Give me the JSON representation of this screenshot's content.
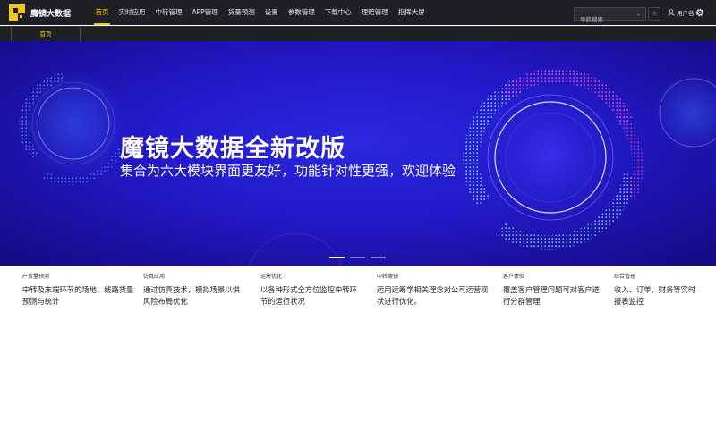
{
  "header": {
    "logo_text": "魔镜大数据",
    "nav": [
      "首页",
      "实时应用",
      "中转管理",
      "APP管理",
      "货量预测",
      "设置",
      "参数管理",
      "下载中心",
      "理赔管理",
      "指挥大屏"
    ],
    "active_nav": 0,
    "search_placeholder": "导航搜索",
    "user_label": "用户名"
  },
  "tabs": [
    "首页"
  ],
  "banner": {
    "title": "魔镜大数据全新改版",
    "subtitle": "集合为六大模块界面更友好，功能针对性更强，欢迎体验",
    "slide_count": 3,
    "active_slide": 0
  },
  "modules": [
    {
      "category": "产货量预测",
      "desc": "中转及末端环节的场地、线路货量预测与统计"
    },
    {
      "category": "仿真应用",
      "desc": "通过仿真技术，模拟场景以供风险布局优化"
    },
    {
      "category": "运筹优化",
      "desc": "以各种形式全方位监控中转环节的运行状况"
    },
    {
      "category": "中转魔镜",
      "desc": "运用运筹学相关理念对公司运营现状进行优化。"
    },
    {
      "category": "客户体验",
      "desc": "覆盖客户管理问题可对客户进行分群管理"
    },
    {
      "category": "综合管理",
      "desc": "收入、订单、财务等实时报表监控"
    }
  ],
  "colors": {
    "accent": "#f5c518",
    "header_bg": "#1f2024",
    "banner_bg": "#2219c8"
  }
}
